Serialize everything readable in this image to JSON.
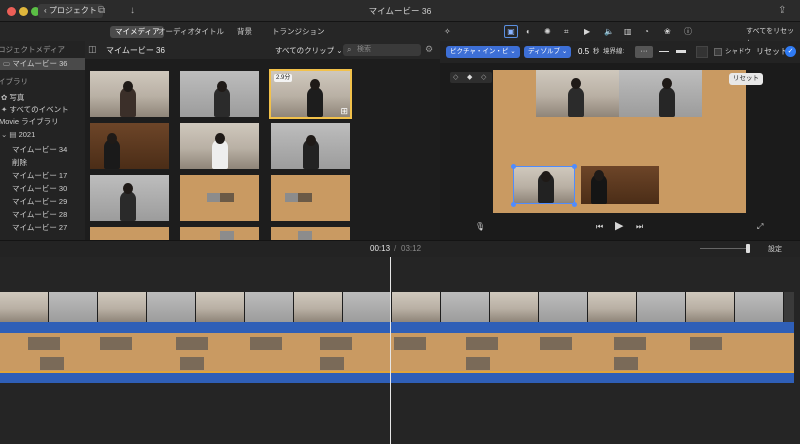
{
  "titlebar": {
    "back_label": "プロジェクト",
    "window_title": "マイムービー 36"
  },
  "tabs": {
    "my_media": "マイメディア",
    "audio": "オーディオ",
    "titles": "タイトル",
    "backgrounds": "背景",
    "transitions": "トランジション"
  },
  "sidebar": {
    "project_media_header": "ロジェクトメディア",
    "project_item": "マイムービー 36",
    "libraries_header": "イブラリ",
    "photos": "写真",
    "all_events": "すべてのイベント",
    "imovie_library": "Movie ライブラリ",
    "year": "2021",
    "events": [
      "マイムービー 34",
      "削除",
      "マイムービー 17",
      "マイムービー 30",
      "マイムービー 29",
      "マイムービー 28",
      "マイムービー 27"
    ]
  },
  "browser": {
    "title": "マイムービー 36",
    "filter": "すべてのクリップ",
    "search_placeholder": "検索",
    "selected_clip_duration": "2.9分"
  },
  "viewer_toolbar": {
    "reset_all": "すべてをリセット"
  },
  "adjust": {
    "overlay_mode": "ピクチャ・イン・ピ",
    "transition_style": "ディゾルブ",
    "duration_value": "0.5",
    "duration_unit": "秒",
    "border_label": "境界線:",
    "shadow_label": "シャドウ",
    "reset": "リセット"
  },
  "viewer": {
    "reset_chip": "リセット"
  },
  "timeline": {
    "current_time": "00:13",
    "separator": "/",
    "total_time": "03:12",
    "settings": "設定"
  },
  "colors": {
    "accent_blue": "#2f5fb7",
    "selection_yellow": "#f2c14a",
    "background_orange": "#c99a62"
  }
}
